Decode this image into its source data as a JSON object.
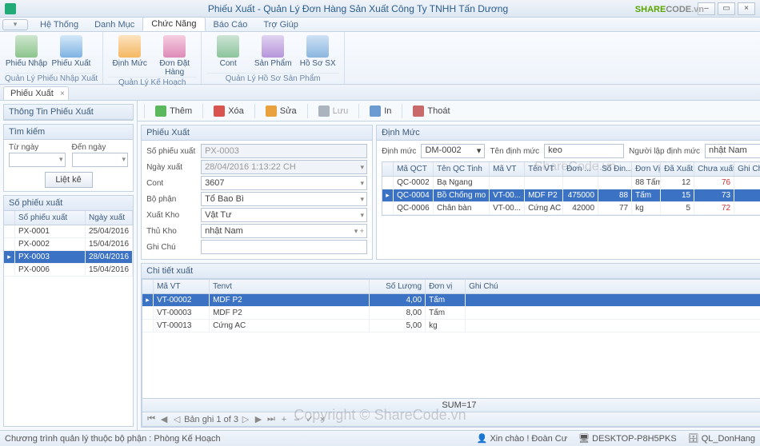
{
  "window": {
    "title": "Phiếu Xuất - Quản Lý Đơn Hàng Sản Xuất Công Ty TNHH Tấn Dương"
  },
  "logo": {
    "a": "SHARE",
    "b": "CODE",
    "c": ".vn"
  },
  "menu": {
    "items": [
      "Hệ Thống",
      "Danh Mục",
      "Chức Năng",
      "Báo Cáo",
      "Trợ Giúp"
    ],
    "active": 2
  },
  "ribbon": {
    "groups": [
      {
        "title": "Quản Lý Phiếu Nhập Xuất",
        "items": [
          "Phiếu Nhập",
          "Phiếu Xuất"
        ]
      },
      {
        "title": "Quản Lý Kế Hoạch",
        "items": [
          "Định Mức",
          "Đơn Đặt Hàng"
        ]
      },
      {
        "title": "Quản Lý Hồ Sơ Sản Phẩm",
        "items": [
          "Cont",
          "Sản Phẩm",
          "Hồ Sơ SX"
        ]
      }
    ]
  },
  "doctab": {
    "label": "Phiếu Xuất"
  },
  "left": {
    "info_title": "Thông Tin Phiếu Xuất",
    "search": {
      "title": "Tìm kiếm",
      "from": "Từ ngày",
      "to": "Đến ngày",
      "list_btn": "Liệt kê"
    },
    "list": {
      "title": "Số phiếu xuất",
      "cols": [
        "Số phiếu xuất",
        "Ngày xuất"
      ],
      "rows": [
        {
          "id": "PX-0001",
          "date": "25/04/2016"
        },
        {
          "id": "PX-0002",
          "date": "15/04/2016"
        },
        {
          "id": "PX-0003",
          "date": "28/04/2016"
        },
        {
          "id": "PX-0006",
          "date": "15/04/2016"
        }
      ],
      "selected": 2
    }
  },
  "toolbar": {
    "add": "Thêm",
    "del": "Xóa",
    "edit": "Sửa",
    "save": "Lưu",
    "print": "In",
    "exit": "Thoát"
  },
  "px": {
    "title": "Phiếu Xuất",
    "fields": {
      "so_label": "Số phiếu xuất",
      "so": "PX-0003",
      "ngay_label": "Ngày xuất",
      "ngay": "28/04/2016 1:13:22 CH",
      "cont_label": "Cont",
      "cont": "3607",
      "bp_label": "Bộ phận",
      "bp": "Tổ Bao Bì",
      "xk_label": "Xuất Kho",
      "xk": "Vật Tư",
      "tk_label": "Thủ Kho",
      "tk": "nhật Nam",
      "gc_label": "Ghi Chú"
    }
  },
  "dm": {
    "title": "Định Mức",
    "head": {
      "dm_label": "Định mức",
      "dm": "DM-0002",
      "ten_label": "Tên định mức",
      "ten": "keo",
      "nl_label": "Người lập định mức",
      "nl": "nhật Nam"
    },
    "cols": [
      "Mã QCT",
      "Tên QC Tinh",
      "Mã VT",
      "Tên VT",
      "Đơn ...",
      "Số Đin...",
      "Đơn Vị",
      "Đã Xuất",
      "Chưa xuất",
      "Ghi Chú"
    ],
    "rows": [
      {
        "ma": "QC-0002",
        "ten": "Bạ Ngang",
        "mavt": "",
        "tenvt": "",
        "don": "",
        "sd": "",
        "dv": "88  Tấm",
        "dx": "12",
        "cx": "76"
      },
      {
        "ma": "QC-0004",
        "ten": "Bồ Chống mo",
        "mavt": "VT-00...",
        "tenvt": "MDF P2",
        "don": "475000",
        "sd": "88",
        "dv": "Tấm",
        "dx": "15",
        "cx": "73"
      },
      {
        "ma": "QC-0006",
        "ten": "Chân bàn",
        "mavt": "VT-00...",
        "tenvt": "Cứng AC",
        "don": "42000",
        "sd": "77",
        "dv": "kg",
        "dx": "5",
        "cx": "72"
      }
    ],
    "selected": 1
  },
  "chit": {
    "title": "Chi tiết xuất",
    "cols": [
      "Mã VT",
      "Tenvt",
      "Số Lượng",
      "Đơn vị",
      "Ghi Chú"
    ],
    "rows": [
      {
        "ma": "VT-00002",
        "ten": "MDF P2",
        "sl": "4,00",
        "dv": "Tấm"
      },
      {
        "ma": "VT-00003",
        "ten": "MDF P2",
        "sl": "8,00",
        "dv": "Tấm"
      },
      {
        "ma": "VT-00013",
        "ten": "Cứng AC",
        "sl": "5,00",
        "dv": "kg"
      }
    ],
    "selected": 0,
    "sum": "SUM=17",
    "nav": "Bản ghi 1 of 3"
  },
  "status": {
    "left": "Chương trình quản lý thuộc bộ phận : Phòng Kế Hoạch",
    "greet": "Xin chào ! Đoàn Cư",
    "host": "DESKTOP-P8H5PKS",
    "db": "QL_DonHang"
  },
  "watermark": "Copyright © ShareCode.vn",
  "watermark2": "ShareCode.vn"
}
